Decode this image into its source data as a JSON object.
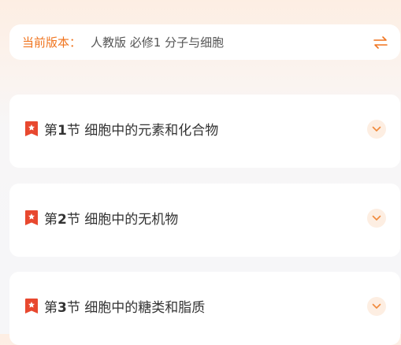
{
  "version_bar": {
    "label": "当前版本：",
    "value": "人教版 必修1 分子与细胞",
    "accent_color": "#f0741e"
  },
  "sections": [
    {
      "prefix": "第",
      "number": "1",
      "suffix": "节 细胞中的元素和化合物"
    },
    {
      "prefix": "第",
      "number": "2",
      "suffix": "节 细胞中的无机物"
    },
    {
      "prefix": "第",
      "number": "3",
      "suffix": "节 细胞中的糖类和脂质"
    }
  ],
  "icons": {
    "swap": "swap-arrows-icon",
    "badge": "star-badge-icon",
    "expand": "chevron-down-icon"
  },
  "colors": {
    "badge": "#e8482f",
    "chevron_bg": "#fdeee2",
    "chevron": "#f08a3c"
  }
}
